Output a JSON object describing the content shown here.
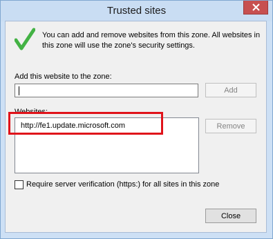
{
  "window": {
    "title": "Trusted sites"
  },
  "intro": {
    "icon": "checkmark-icon",
    "text": "You can add and remove websites from this zone. All websites in this zone will use the zone's security settings."
  },
  "add": {
    "label": "Add this website to the zone:",
    "value": "",
    "button": "Add"
  },
  "websites": {
    "label": "Websites:",
    "items": [
      "http://fe1.update.microsoft.com"
    ],
    "remove_button": "Remove"
  },
  "verification": {
    "label": "Require server verification (https:) for all sites in this zone",
    "checked": false
  },
  "footer": {
    "close_button": "Close"
  },
  "colors": {
    "highlight": "#e0121a",
    "check": "#43b244",
    "title_close": "#c75050"
  }
}
